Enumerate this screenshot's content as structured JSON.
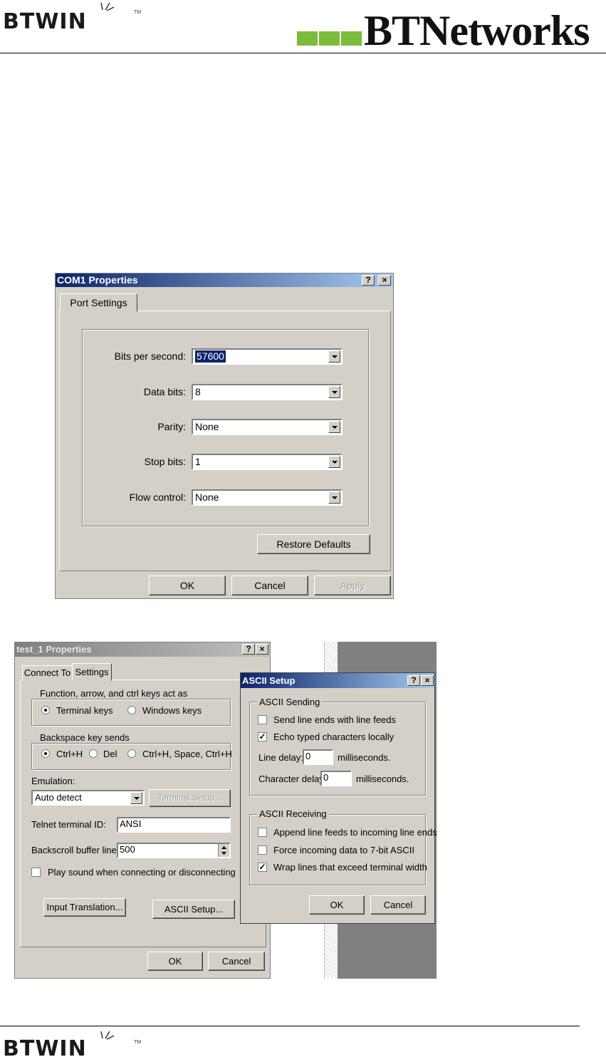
{
  "header": {
    "brand_left": "BTWIN",
    "brand_tm": "TM",
    "brand_right": "BTNetworks"
  },
  "footer": {
    "brand": "BTWIN",
    "brand_tm": "TM"
  },
  "colors": {
    "accent_green": "#7dbb3a",
    "title_active": "#0a246a",
    "dialog_bg": "#d4d0c8"
  },
  "com1": {
    "title": "COM1 Properties",
    "help_glyph": "?",
    "close_glyph": "×",
    "tab": "Port Settings",
    "fields": [
      {
        "label": "Bits per second:",
        "value": "57600"
      },
      {
        "label": "Data bits:",
        "value": "8"
      },
      {
        "label": "Parity:",
        "value": "None"
      },
      {
        "label": "Stop bits:",
        "value": "1"
      },
      {
        "label": "Flow control:",
        "value": "None"
      }
    ],
    "restore_defaults": "Restore Defaults",
    "ok": "OK",
    "cancel": "Cancel",
    "apply": "Apply"
  },
  "test1": {
    "title": "test_1 Properties",
    "help_glyph": "?",
    "close_glyph": "×",
    "tab_connect": "Connect To",
    "tab_settings": "Settings",
    "func_group": "Function, arrow, and ctrl keys act as",
    "func_terminal": "Terminal keys",
    "func_windows": "Windows keys",
    "back_group": "Backspace key sends",
    "back_ctrlh": "Ctrl+H",
    "back_del": "Del",
    "back_combo": "Ctrl+H, Space, Ctrl+H",
    "emulation_label": "Emulation:",
    "emulation_value": "Auto detect",
    "terminal_setup": "Terminal Setup...",
    "telnet_label": "Telnet terminal ID:",
    "telnet_value": "ANSI",
    "backscroll_label": "Backscroll buffer lines:",
    "backscroll_value": "500",
    "play_sound": "Play sound when connecting or disconnecting",
    "input_translation": "Input Translation...",
    "ascii_setup": "ASCII Setup...",
    "ok": "OK",
    "cancel": "Cancel"
  },
  "ascii": {
    "title": "ASCII Setup",
    "help_glyph": "?",
    "close_glyph": "×",
    "sending_group": "ASCII Sending",
    "send_line_ends": "Send line ends with line feeds",
    "echo_typed": "Echo typed characters locally",
    "line_delay_label": "Line delay:",
    "line_delay_value": "0",
    "line_delay_unit": "milliseconds.",
    "char_delay_label": "Character delay:",
    "char_delay_value": "0",
    "char_delay_unit": "milliseconds.",
    "receiving_group": "ASCII Receiving",
    "append_lf": "Append line feeds to incoming line ends",
    "force_7bit": "Force incoming data to 7-bit ASCII",
    "wrap_lines": "Wrap lines that exceed terminal width",
    "check_mark": "✓",
    "ok": "OK",
    "cancel": "Cancel"
  }
}
